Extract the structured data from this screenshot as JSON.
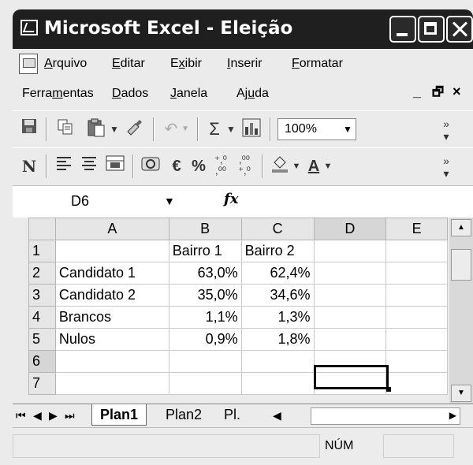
{
  "window": {
    "title": "Microsoft Excel - Eleição"
  },
  "menu": {
    "row1": [
      {
        "pre": "",
        "u": "A",
        "post": "rquivo"
      },
      {
        "pre": "",
        "u": "E",
        "post": "ditar"
      },
      {
        "pre": "E",
        "u": "x",
        "post": "ibir"
      },
      {
        "pre": "",
        "u": "I",
        "post": "nserir"
      },
      {
        "pre": "",
        "u": "F",
        "post": "ormatar"
      }
    ],
    "row2": [
      {
        "pre": "Ferra",
        "u": "m",
        "post": "entas"
      },
      {
        "pre": "",
        "u": "D",
        "post": "ados"
      },
      {
        "pre": "",
        "u": "J",
        "post": "anela"
      },
      {
        "pre": "Aj",
        "u": "u",
        "post": "da"
      }
    ],
    "doc_controls": [
      "_",
      "🗗",
      "×"
    ]
  },
  "toolbar1": {
    "zoom": "100%",
    "sigma": "Σ"
  },
  "toolbar2": {
    "bold": "N",
    "euro": "€",
    "percent": "%",
    "inc_dec": "⁺⁰⁰",
    "dec_dec": "⁰⁰"
  },
  "formula_bar": {
    "name_box": "D6",
    "fx": "fx",
    "value": ""
  },
  "sheet": {
    "columns": [
      "A",
      "B",
      "C",
      "D",
      "E"
    ],
    "rows": [
      {
        "n": "1",
        "a": "",
        "b": "Bairro 1",
        "c": "Bairro 2",
        "d": "",
        "e": ""
      },
      {
        "n": "2",
        "a": "Candidato 1",
        "b": "63,0%",
        "c": "62,4%",
        "d": "",
        "e": ""
      },
      {
        "n": "3",
        "a": "Candidato 2",
        "b": "35,0%",
        "c": "34,6%",
        "d": "",
        "e": ""
      },
      {
        "n": "4",
        "a": "Brancos",
        "b": "1,1%",
        "c": "1,3%",
        "d": "",
        "e": ""
      },
      {
        "n": "5",
        "a": "Nulos",
        "b": "0,9%",
        "c": "1,8%",
        "d": "",
        "e": ""
      },
      {
        "n": "6",
        "a": "",
        "b": "",
        "c": "",
        "d": "",
        "e": ""
      },
      {
        "n": "7",
        "a": "",
        "b": "",
        "c": "",
        "d": "",
        "e": ""
      }
    ],
    "active_cell": "D6"
  },
  "tabs": [
    "Plan1",
    "Plan2",
    "Pl."
  ],
  "status": {
    "num": "NÚM"
  }
}
